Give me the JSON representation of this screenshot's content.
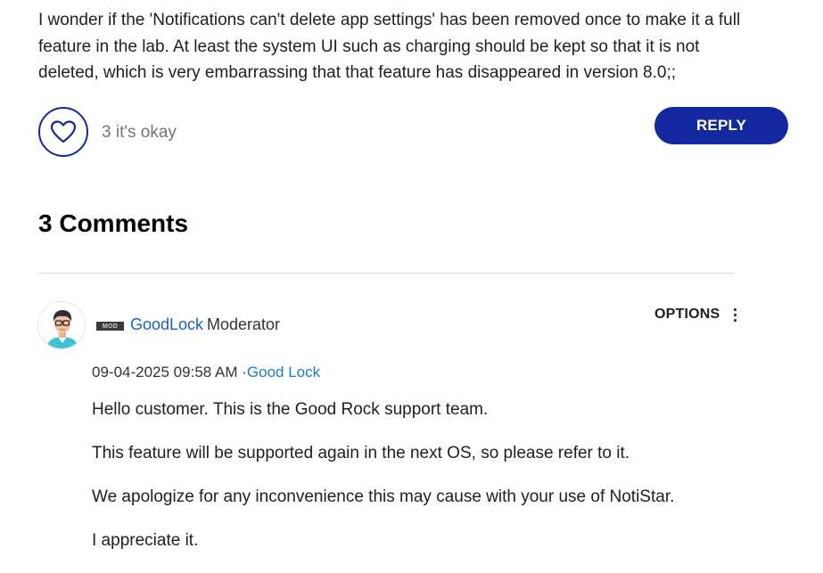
{
  "post": {
    "body_lines": [
      "I wonder if the 'Notifications can't delete app settings' has been removed once to make it a full",
      "feature in the lab. At least the system UI such as charging should be kept so that it is not",
      "deleted, which is very embarrassing that that feature has disappeared in version 8.0;;"
    ],
    "like_icon": "heart-icon",
    "like_count_label": "3 it's okay",
    "reply_label": "REPLY"
  },
  "comments_section": {
    "heading": "3 Comments"
  },
  "comment": {
    "avatar_icon": "user-avatar-icon",
    "badge": "MOD",
    "author": "GoodLock",
    "role": "Moderator",
    "options_label": "OPTIONS",
    "options_icon": "kebab-menu-icon",
    "timestamp": "09-04-2025 09:58 AM",
    "separator": "·",
    "board": "Good Lock",
    "paragraphs": [
      "Hello customer. This is the Good Rock support team.",
      "This feature will be supported again in the next OS, so please refer to it.",
      "We apologize for any inconvenience this may cause with your use of NotiStar.",
      "I appreciate it."
    ]
  },
  "colors": {
    "accent": "#1428a0",
    "link": "#1a5fc8",
    "board_link": "#1a7fbf"
  }
}
